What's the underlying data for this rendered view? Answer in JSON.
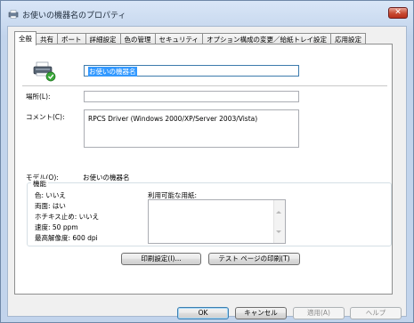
{
  "window": {
    "title": "お使いの機器名のプロパティ",
    "close_glyph": "✕"
  },
  "tabs": [
    "全般",
    "共有",
    "ポート",
    "詳細設定",
    "色の管理",
    "セキュリティ",
    "オプション構成の変更／給紙トレイ設定",
    "応用設定"
  ],
  "general": {
    "printer_name": "お使いの機器名",
    "location_label": "場所(L):",
    "location_value": "",
    "comment_label": "コメント(C):",
    "comment_value": "RPCS Driver (Windows 2000/XP/Server 2003/Vista)",
    "model_label": "モデル(O):",
    "model_value": "お使いの機器名",
    "features": {
      "title": "機能",
      "color": "色: いいえ",
      "duplex": "両面: はい",
      "staple": "ホチキス止め: いいえ",
      "speed": "速度: 50 ppm",
      "resolution": "最高解像度: 600 dpi",
      "paper_label": "利用可能な用紙:"
    },
    "print_settings_button": "印刷設定(I)...",
    "test_page_button": "テスト ページの印刷(T)"
  },
  "footer": {
    "ok": "OK",
    "cancel": "キャンセル",
    "apply": "適用(A)",
    "help": "ヘルプ"
  }
}
